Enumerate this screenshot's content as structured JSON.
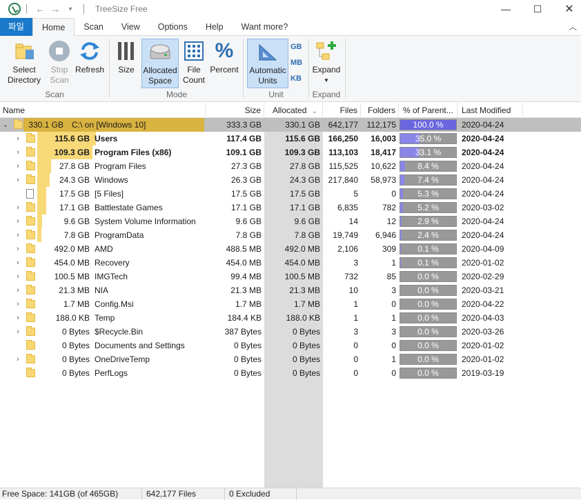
{
  "window": {
    "title": "TreeSize Free"
  },
  "ribbon_tabs": [
    "파일",
    "Home",
    "Scan",
    "View",
    "Options",
    "Help",
    "Want more?"
  ],
  "ribbon": {
    "select_directory": "Select\nDirectory",
    "stop_scan": "Stop\nScan",
    "refresh": "Refresh",
    "size": "Size",
    "allocated_space": "Allocated\nSpace",
    "file_count": "File\nCount",
    "percent": "Percent",
    "automatic_units": "Automatic\nUnits",
    "unit_gb": "GB",
    "unit_mb": "MB",
    "unit_kb": "KB",
    "expand": "Expand",
    "groups": {
      "scan": "Scan",
      "mode": "Mode",
      "unit": "Unit",
      "expand": "Expand"
    }
  },
  "columns": [
    "Name",
    "Size",
    "Allocated",
    "Files",
    "Folders",
    "% of Parent...",
    "Last Modified"
  ],
  "rows": [
    {
      "alloc_label": "330.1 GB",
      "name": "C:\\  on  [Windows 10]",
      "size": "333.3 GB",
      "allocated": "330.1 GB",
      "files": "642,177",
      "folders": "112,175",
      "pct": "100.0 %",
      "pct_value": 100.0,
      "modified": "2020-04-24",
      "level": 0,
      "expanded": true,
      "bold": false,
      "root": true,
      "icon": "folder-icon",
      "bar_fraction": 1.0
    },
    {
      "alloc_label": "115.6 GB",
      "name": "Users",
      "size": "117.4 GB",
      "allocated": "115.6 GB",
      "files": "166,250",
      "folders": "16,003",
      "pct": "35.0 %",
      "pct_value": 35.0,
      "modified": "2020-04-24",
      "level": 1,
      "expanded": false,
      "bold": true,
      "icon": "folder-icon",
      "bar_fraction": 0.35
    },
    {
      "alloc_label": "109.3 GB",
      "name": "Program Files (x86)",
      "size": "109.1 GB",
      "allocated": "109.3 GB",
      "files": "113,103",
      "folders": "18,417",
      "pct": "33.1 %",
      "pct_value": 33.1,
      "modified": "2020-04-24",
      "level": 1,
      "expanded": false,
      "bold": true,
      "icon": "folder-icon",
      "bar_fraction": 0.331
    },
    {
      "alloc_label": "27.8 GB",
      "name": "Program Files",
      "size": "27.3 GB",
      "allocated": "27.8 GB",
      "files": "115,525",
      "folders": "10,622",
      "pct": "8.4 %",
      "pct_value": 8.4,
      "modified": "2020-04-24",
      "level": 1,
      "expanded": false,
      "bold": false,
      "icon": "folder-icon",
      "bar_fraction": 0.084
    },
    {
      "alloc_label": "24.3 GB",
      "name": "Windows",
      "size": "26.3 GB",
      "allocated": "24.3 GB",
      "files": "217,840",
      "folders": "58,973",
      "pct": "7.4 %",
      "pct_value": 7.4,
      "modified": "2020-04-24",
      "level": 1,
      "expanded": false,
      "bold": false,
      "icon": "folder-icon",
      "bar_fraction": 0.074
    },
    {
      "alloc_label": "17.5 GB",
      "name": "[5 Files]",
      "size": "17.5 GB",
      "allocated": "17.5 GB",
      "files": "5",
      "folders": "0",
      "pct": "5.3 %",
      "pct_value": 5.3,
      "modified": "2020-04-24",
      "level": 1,
      "expanded": null,
      "bold": false,
      "icon": "file-icon",
      "bar_fraction": 0.053
    },
    {
      "alloc_label": "17.1 GB",
      "name": "Battlestate Games",
      "size": "17.1 GB",
      "allocated": "17.1 GB",
      "files": "6,835",
      "folders": "782",
      "pct": "5.2 %",
      "pct_value": 5.2,
      "modified": "2020-03-02",
      "level": 1,
      "expanded": false,
      "bold": false,
      "icon": "folder-icon",
      "bar_fraction": 0.052
    },
    {
      "alloc_label": "9.6 GB",
      "name": "System Volume Information",
      "size": "9.6 GB",
      "allocated": "9.6 GB",
      "files": "14",
      "folders": "12",
      "pct": "2.9 %",
      "pct_value": 2.9,
      "modified": "2020-04-24",
      "level": 1,
      "expanded": false,
      "bold": false,
      "icon": "folder-icon",
      "bar_fraction": 0.029
    },
    {
      "alloc_label": "7.8 GB",
      "name": "ProgramData",
      "size": "7.8 GB",
      "allocated": "7.8 GB",
      "files": "19,749",
      "folders": "6,946",
      "pct": "2.4 %",
      "pct_value": 2.4,
      "modified": "2020-04-24",
      "level": 1,
      "expanded": false,
      "bold": false,
      "icon": "folder-icon",
      "bar_fraction": 0.024
    },
    {
      "alloc_label": "492.0 MB",
      "name": "AMD",
      "size": "488.5 MB",
      "allocated": "492.0 MB",
      "files": "2,106",
      "folders": "309",
      "pct": "0.1 %",
      "pct_value": 0.1,
      "modified": "2020-04-09",
      "level": 1,
      "expanded": false,
      "bold": false,
      "icon": "folder-icon",
      "bar_fraction": 0.0
    },
    {
      "alloc_label": "454.0 MB",
      "name": "Recovery",
      "size": "454.0 MB",
      "allocated": "454.0 MB",
      "files": "3",
      "folders": "1",
      "pct": "0.1 %",
      "pct_value": 0.1,
      "modified": "2020-01-02",
      "level": 1,
      "expanded": false,
      "bold": false,
      "icon": "folder-icon",
      "bar_fraction": 0.0
    },
    {
      "alloc_label": "100.5 MB",
      "name": "IMGTech",
      "size": "99.4 MB",
      "allocated": "100.5 MB",
      "files": "732",
      "folders": "85",
      "pct": "0.0 %",
      "pct_value": 0.0,
      "modified": "2020-02-29",
      "level": 1,
      "expanded": false,
      "bold": false,
      "icon": "folder-icon",
      "bar_fraction": 0.0
    },
    {
      "alloc_label": "21.3 MB",
      "name": "NIA",
      "size": "21.3 MB",
      "allocated": "21.3 MB",
      "files": "10",
      "folders": "3",
      "pct": "0.0 %",
      "pct_value": 0.0,
      "modified": "2020-03-21",
      "level": 1,
      "expanded": false,
      "bold": false,
      "icon": "folder-icon",
      "bar_fraction": 0.0
    },
    {
      "alloc_label": "1.7 MB",
      "name": "Config.Msi",
      "size": "1.7 MB",
      "allocated": "1.7 MB",
      "files": "1",
      "folders": "0",
      "pct": "0.0 %",
      "pct_value": 0.0,
      "modified": "2020-04-22",
      "level": 1,
      "expanded": false,
      "bold": false,
      "icon": "folder-icon",
      "bar_fraction": 0.0
    },
    {
      "alloc_label": "188.0 KB",
      "name": "Temp",
      "size": "184.4 KB",
      "allocated": "188.0 KB",
      "files": "1",
      "folders": "1",
      "pct": "0.0 %",
      "pct_value": 0.0,
      "modified": "2020-04-03",
      "level": 1,
      "expanded": false,
      "bold": false,
      "icon": "folder-icon",
      "bar_fraction": 0.0
    },
    {
      "alloc_label": "0 Bytes",
      "name": "$Recycle.Bin",
      "size": "387 Bytes",
      "allocated": "0 Bytes",
      "files": "3",
      "folders": "3",
      "pct": "0.0 %",
      "pct_value": 0.0,
      "modified": "2020-03-26",
      "level": 1,
      "expanded": false,
      "bold": false,
      "icon": "folder-icon",
      "bar_fraction": 0.0
    },
    {
      "alloc_label": "0 Bytes",
      "name": "Documents and Settings",
      "size": "0 Bytes",
      "allocated": "0 Bytes",
      "files": "0",
      "folders": "0",
      "pct": "0.0 %",
      "pct_value": 0.0,
      "modified": "2020-01-02",
      "level": 1,
      "expanded": null,
      "bold": false,
      "icon": "shortcut-folder-icon",
      "bar_fraction": 0.0
    },
    {
      "alloc_label": "0 Bytes",
      "name": "OneDriveTemp",
      "size": "0 Bytes",
      "allocated": "0 Bytes",
      "files": "0",
      "folders": "1",
      "pct": "0.0 %",
      "pct_value": 0.0,
      "modified": "2020-01-02",
      "level": 1,
      "expanded": false,
      "bold": false,
      "icon": "folder-icon",
      "bar_fraction": 0.0
    },
    {
      "alloc_label": "0 Bytes",
      "name": "PerfLogs",
      "size": "0 Bytes",
      "allocated": "0 Bytes",
      "files": "0",
      "folders": "0",
      "pct": "0.0 %",
      "pct_value": 0.0,
      "modified": "2019-03-19",
      "level": 1,
      "expanded": null,
      "bold": false,
      "icon": "folder-icon",
      "bar_fraction": 0.0
    }
  ],
  "status": {
    "free_space": "Free Space: 141GB  (of 465GB)",
    "files": "642,177 Files",
    "excluded": "0 Excluded"
  },
  "colors": {
    "accent": "#1979ca",
    "bar": "#f7d978",
    "pct_fill": "#8a86e8",
    "root_row": "#bfbfbf"
  }
}
